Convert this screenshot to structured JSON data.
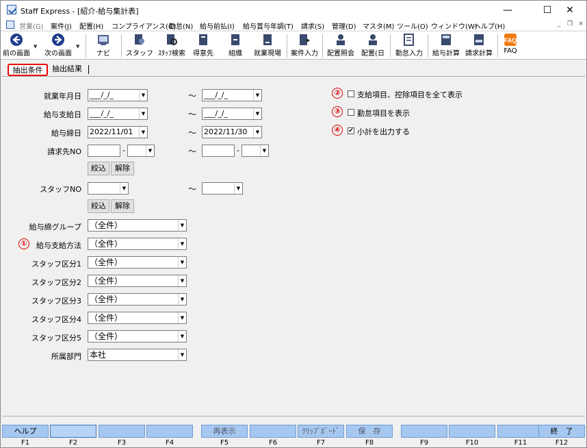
{
  "window": {
    "title": "Staff Express - [紹介-給与集計表]",
    "min": "—",
    "max": "☐",
    "close": "✕"
  },
  "menu": [
    {
      "label": "営業(G)",
      "dim": true
    },
    {
      "label": "案件(J)"
    },
    {
      "label": "配置(H)"
    },
    {
      "label": "コンプライアンス(C)"
    },
    {
      "label": "勤怠(N)"
    },
    {
      "label": "給与前払(I)"
    },
    {
      "label": "給与賞与年調(T)"
    },
    {
      "label": "請求(S)"
    },
    {
      "label": "管理(D)"
    },
    {
      "label": "マスタ(M)"
    },
    {
      "label": "ツール(O)"
    },
    {
      "label": "ウィンドウ(W)"
    },
    {
      "label": "ヘルプ(H)"
    }
  ],
  "mdi": {
    "min": "_",
    "restore": "❐",
    "close": "×"
  },
  "toolbar": [
    {
      "label": "前の画面",
      "icon": "back-arrow-icon"
    },
    {
      "label": "次の画面",
      "icon": "forward-arrow-icon"
    },
    {
      "label": "ナビ",
      "icon": "navi-icon"
    },
    {
      "label": "スタッフ",
      "icon": "staff-icon"
    },
    {
      "label": "ｽﾀｯﾌ検索",
      "icon": "staff-search-icon"
    },
    {
      "label": "得意先",
      "icon": "client-icon"
    },
    {
      "label": "組織",
      "icon": "organization-icon"
    },
    {
      "label": "就業現場",
      "icon": "workplace-icon"
    },
    {
      "label": "案件入力",
      "icon": "case-input-icon"
    },
    {
      "label": "配置照会",
      "icon": "placement-query-icon"
    },
    {
      "label": "配置(日",
      "icon": "placement-day-icon"
    },
    {
      "label": "勤怠入力",
      "icon": "attendance-input-icon"
    },
    {
      "label": "給与計算",
      "icon": "payroll-calc-icon"
    },
    {
      "label": "請求計算",
      "icon": "billing-calc-icon"
    },
    {
      "label": "FAQ",
      "icon": "faq-icon"
    }
  ],
  "tabs": {
    "active": "抽出条件",
    "second": "抽出結果"
  },
  "form": {
    "work_month": {
      "label": "就業年月日",
      "from": "___/_/_",
      "to": "___/_/_"
    },
    "pay_date": {
      "label": "給与支給日",
      "from": "___/_/_",
      "to": "___/_/_"
    },
    "closing_date": {
      "label": "給与締日",
      "from": "2022/11/01",
      "to": "2022/11/30"
    },
    "client_no": {
      "label": "請求先NO"
    },
    "staff_no": {
      "label": "スタッフNO"
    },
    "narrow_button": "絞込",
    "clear_button": "解除",
    "tilde": "～",
    "dash": "-",
    "closing_group": {
      "label": "給与締グループ",
      "value": "（全件）"
    },
    "pay_method": {
      "label": "給与支給方法",
      "value": "（全件）",
      "marker": "①"
    },
    "staff_class1": {
      "label": "スタッフ区分1",
      "value": "（全件）"
    },
    "staff_class2": {
      "label": "スタッフ区分2",
      "value": "（全件）"
    },
    "staff_class3": {
      "label": "スタッフ区分3",
      "value": "（全件）"
    },
    "staff_class4": {
      "label": "スタッフ区分4",
      "value": "（全件）"
    },
    "staff_class5": {
      "label": "スタッフ区分5",
      "value": "（全件）"
    },
    "department": {
      "label": "所属部門",
      "value": "本社"
    }
  },
  "options": [
    {
      "marker": "②",
      "label": "支給項目、控除項目を全て表示",
      "checked": false
    },
    {
      "marker": "③",
      "label": "勤怠項目を表示",
      "checked": false
    },
    {
      "marker": "④",
      "label": "小計を出力する",
      "checked": true
    }
  ],
  "fkeys": [
    {
      "key": "F1",
      "label": "ヘルプ"
    },
    {
      "key": "F2",
      "label": ""
    },
    {
      "key": "F3",
      "label": ""
    },
    {
      "key": "F4",
      "label": ""
    },
    {
      "key": "F5",
      "label": "再表示"
    },
    {
      "key": "F6",
      "label": ""
    },
    {
      "key": "F7",
      "label": "ｸﾘｯﾌﾟﾎﾞｰﾄﾞ"
    },
    {
      "key": "F8",
      "label": "保　存"
    },
    {
      "key": "F9",
      "label": ""
    },
    {
      "key": "F10",
      "label": ""
    },
    {
      "key": "F11",
      "label": ""
    },
    {
      "key": "F12",
      "label": "終　了"
    }
  ],
  "colors": {
    "accent_red": "#dd0000",
    "fkey_blue": "#a6c8f0"
  }
}
